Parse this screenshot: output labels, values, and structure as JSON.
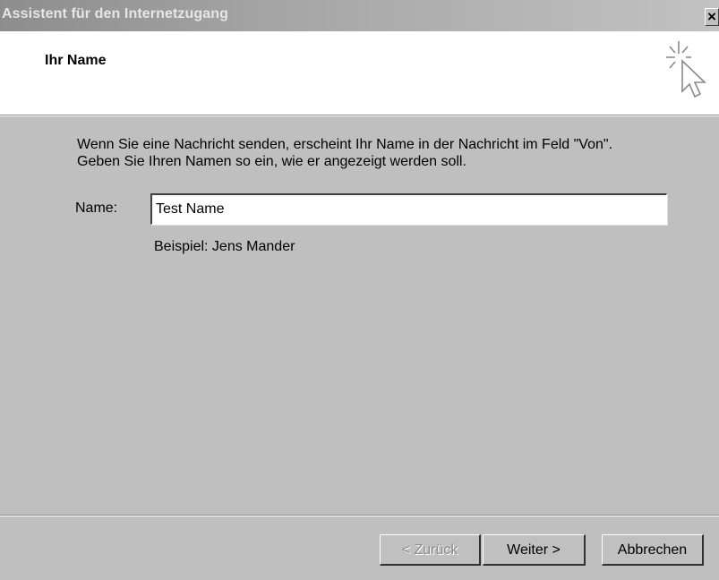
{
  "window": {
    "title": "Assistent für den Internetzugang",
    "close_glyph": "×"
  },
  "header": {
    "title": "Ihr Name",
    "icon": "wizard-cursor-sparkle-icon"
  },
  "body": {
    "intro_line1": "Wenn Sie eine Nachricht senden, erscheint Ihr Name in der Nachricht im Feld \"Von\".",
    "intro_line2": "Geben Sie Ihren Namen so ein, wie er angezeigt werden soll.",
    "name_label": "Name:",
    "name_value": "Test Name",
    "example": "Beispiel: Jens Mander"
  },
  "buttons": {
    "back_label": "< Zurück",
    "next_label": "Weiter >",
    "cancel_label": "Abbrechen"
  },
  "colors": {
    "dialog_bg": "#bfbfbf",
    "header_bg": "#ffffff",
    "disabled_text": "#8c8c8c"
  }
}
